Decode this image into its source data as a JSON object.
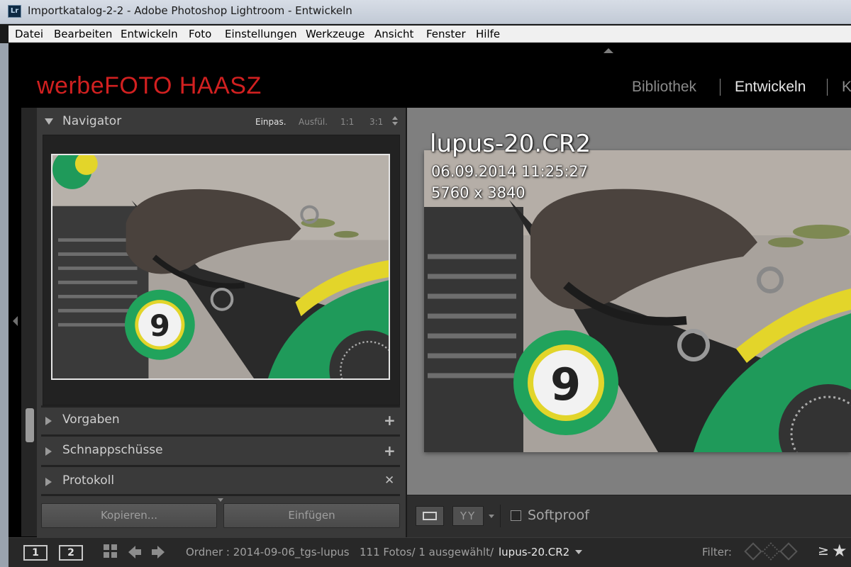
{
  "window": {
    "app_icon": "Lr",
    "title": "Importkatalog-2-2 - Adobe Photoshop Lightroom - Entwickeln"
  },
  "menu": [
    "Datei",
    "Bearbeiten",
    "Entwickeln",
    "Foto",
    "Einstellungen",
    "Werkzeuge",
    "Ansicht",
    "Fenster",
    "Hilfe"
  ],
  "identity_plate": "werbeFOTO  HAASZ",
  "modules": [
    "Bibliothek",
    "Entwickeln",
    "K"
  ],
  "active_module": "Entwickeln",
  "navigator": {
    "title": "Navigator",
    "zoom_options": [
      "Einpas.",
      "Ausfül.",
      "1:1",
      "3:1"
    ],
    "selected_zoom": "Einpas."
  },
  "panels": [
    {
      "title": "Vorgaben",
      "action": "plus"
    },
    {
      "title": "Schnappschüsse",
      "action": "plus"
    },
    {
      "title": "Protokoll",
      "action": "close"
    }
  ],
  "buttons": {
    "copy": "Kopieren...",
    "paste": "Einfügen"
  },
  "photo_info": {
    "filename": "lupus-20.CR2",
    "datetime": "06.09.2014 11:25:27",
    "dimensions": "5760 x 3840"
  },
  "toolbar": {
    "yy_label": "YY",
    "softproof_label": "Softproof",
    "softproof_checked": false
  },
  "filmstrip": {
    "screen1": "1",
    "screen2": "2",
    "source": "Ordner : 2014-09-06_tgs-lupus",
    "count": "111 Fotos/ 1 ausgewählt/",
    "current_file": "lupus-20.CR2",
    "filter_label": "Filter:",
    "rating_op": "≥",
    "rating_star": "★"
  },
  "colors": {
    "identity_red": "#d12020",
    "panel_bg": "#3a3a3a",
    "view_bg": "#7f7f7f"
  }
}
